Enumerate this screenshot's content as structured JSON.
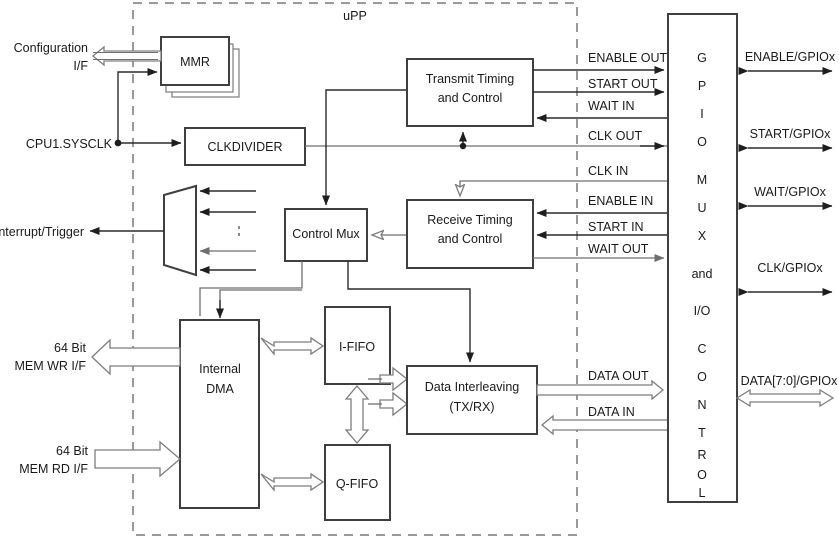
{
  "diagram": {
    "title": "uPP",
    "boundary_label": "uPP"
  },
  "blocks": {
    "mmr": "MMR",
    "clkdivider": "CLKDIVIDER",
    "control_mux": "Control  Mux",
    "transmit": {
      "line1": "Transmit Timing",
      "line2": "and Control"
    },
    "receive": {
      "line1": "Receive Timing",
      "line2": "and Control"
    },
    "internal_dma": {
      "line1": "Internal",
      "line2": "DMA"
    },
    "i_fifo": "I-FIFO",
    "q_fifo": "Q-FIFO",
    "data_interleaving": {
      "line1": "Data Interleaving",
      "line2": "(TX/RX)"
    },
    "gpio_mux": {
      "letters": [
        "G",
        "P",
        "I",
        "O",
        "M",
        "U",
        "X",
        "and",
        "I/O",
        "C",
        "O",
        "N",
        "T",
        "R",
        "O",
        "L"
      ],
      "full_text": "GPIO MUX and I/O CONTROL"
    }
  },
  "left_ports": {
    "configuration": {
      "line1": "Configuration",
      "line2": "I/F"
    },
    "sysclk": "CPU1.SYSCLK",
    "interrupt": "Interrupt/Trigger",
    "mem_wr": {
      "line1": "64 Bit",
      "line2": "MEM WR I/F"
    },
    "mem_rd": {
      "line1": "64 Bit",
      "line2": "MEM RD I/F"
    }
  },
  "internal_signals": [
    {
      "label": "ENABLE OUT",
      "direction": "out"
    },
    {
      "label": "START OUT",
      "direction": "out"
    },
    {
      "label": "WAIT IN",
      "direction": "in"
    },
    {
      "label": "CLK OUT",
      "direction": "out"
    },
    {
      "label": "CLK IN",
      "direction": "in"
    },
    {
      "label": "ENABLE IN",
      "direction": "in"
    },
    {
      "label": "START IN",
      "direction": "in"
    },
    {
      "label": "WAIT OUT",
      "direction": "out"
    },
    {
      "label": "DATA OUT",
      "direction": "out"
    },
    {
      "label": "DATA IN",
      "direction": "in"
    }
  ],
  "external_signals": [
    {
      "label": "ENABLE/GPIOx",
      "style": "bidir-solid"
    },
    {
      "label": "START/GPIOx",
      "style": "bidir-solid"
    },
    {
      "label": "WAIT/GPIOx",
      "style": "bidir-solid"
    },
    {
      "label": "CLK/GPIOx",
      "style": "bidir-solid"
    },
    {
      "label": "DATA[7:0]/GPIOx",
      "style": "bidir-hollow"
    }
  ],
  "colors": {
    "block_stroke": "#3f3f3f",
    "line": "#6f6f6f",
    "dark_line": "#2b2b2b",
    "boundary_dash": "#9a9a9a",
    "background": "#ffffff",
    "text": "#1a1a1a"
  }
}
